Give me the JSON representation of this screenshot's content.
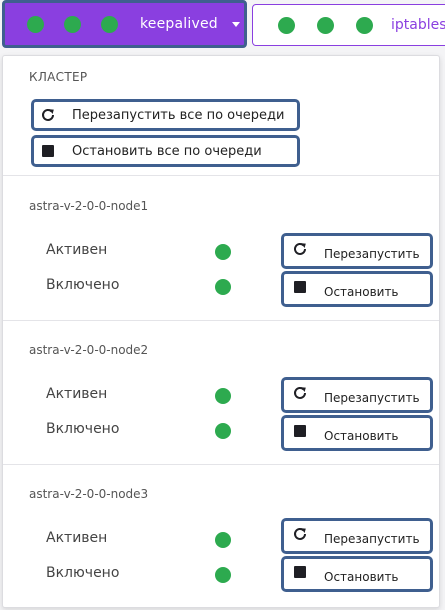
{
  "tabs": [
    {
      "label": "keepalived",
      "dots": 3,
      "active": true
    },
    {
      "label": "iptables",
      "dots": 3,
      "active": false
    }
  ],
  "colors": {
    "accent": "#8a3fe0",
    "ok": "#2daa4f",
    "highlight": "#3f5f8f"
  },
  "cluster": {
    "title": "КЛАСТЕР",
    "restart_all": "Перезапустить все по очереди",
    "stop_all": "Остановить все по очереди",
    "restart_icon": "restart-icon",
    "stop_icon": "stop-icon"
  },
  "nodes": [
    {
      "name": "astra-v-2-0-0-node1",
      "active_label": "Активен",
      "enabled_label": "Включено",
      "restart": "Перезапустить",
      "stop": "Остановить"
    },
    {
      "name": "astra-v-2-0-0-node2",
      "active_label": "Активен",
      "enabled_label": "Включено",
      "restart": "Перезапустить",
      "stop": "Остановить"
    },
    {
      "name": "astra-v-2-0-0-node3",
      "active_label": "Активен",
      "enabled_label": "Включено",
      "restart": "Перезапустить",
      "stop": "Остановить"
    }
  ]
}
